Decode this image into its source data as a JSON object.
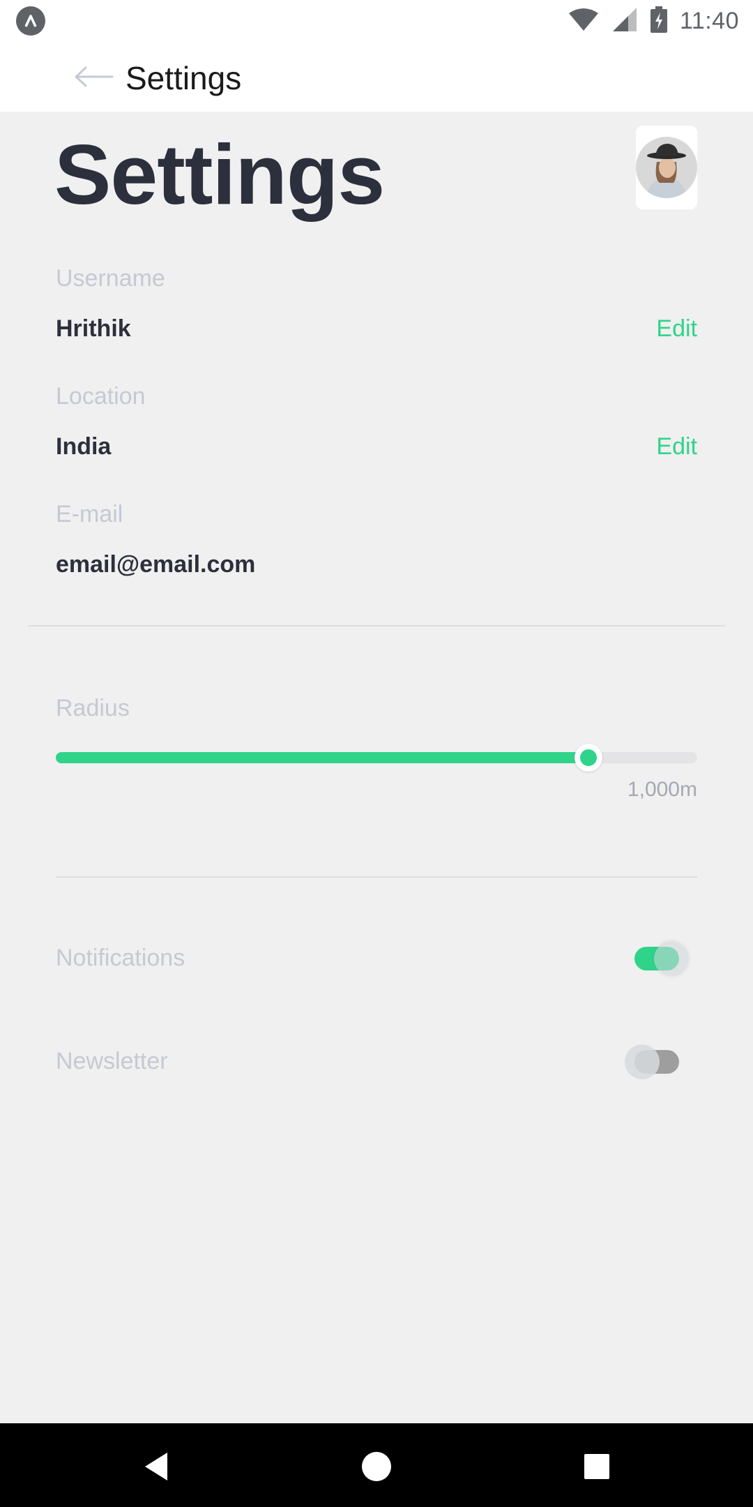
{
  "status_bar": {
    "time": "11:40"
  },
  "app_bar": {
    "title": "Settings"
  },
  "page": {
    "heading": "Settings"
  },
  "fields": {
    "username": {
      "label": "Username",
      "value": "Hrithik",
      "action": "Edit"
    },
    "location": {
      "label": "Location",
      "value": "India",
      "action": "Edit"
    },
    "email": {
      "label": "E-mail",
      "value": "email@email.com"
    }
  },
  "radius": {
    "label": "Radius",
    "value_text": "1,000m",
    "fill_fraction": 0.83
  },
  "toggles": {
    "notifications": {
      "label": "Notifications",
      "on": true
    },
    "newsletter": {
      "label": "Newsletter",
      "on": false
    }
  },
  "colors": {
    "accent": "#2fd48a",
    "title": "#2c2f3c",
    "muted": "#c5c9d3",
    "background": "#f0f0f0"
  },
  "icons": [
    "app-icon",
    "wifi-icon",
    "signal-icon",
    "battery-icon",
    "back-arrow-icon",
    "nav-back-icon",
    "nav-home-icon",
    "nav-recents-icon"
  ]
}
